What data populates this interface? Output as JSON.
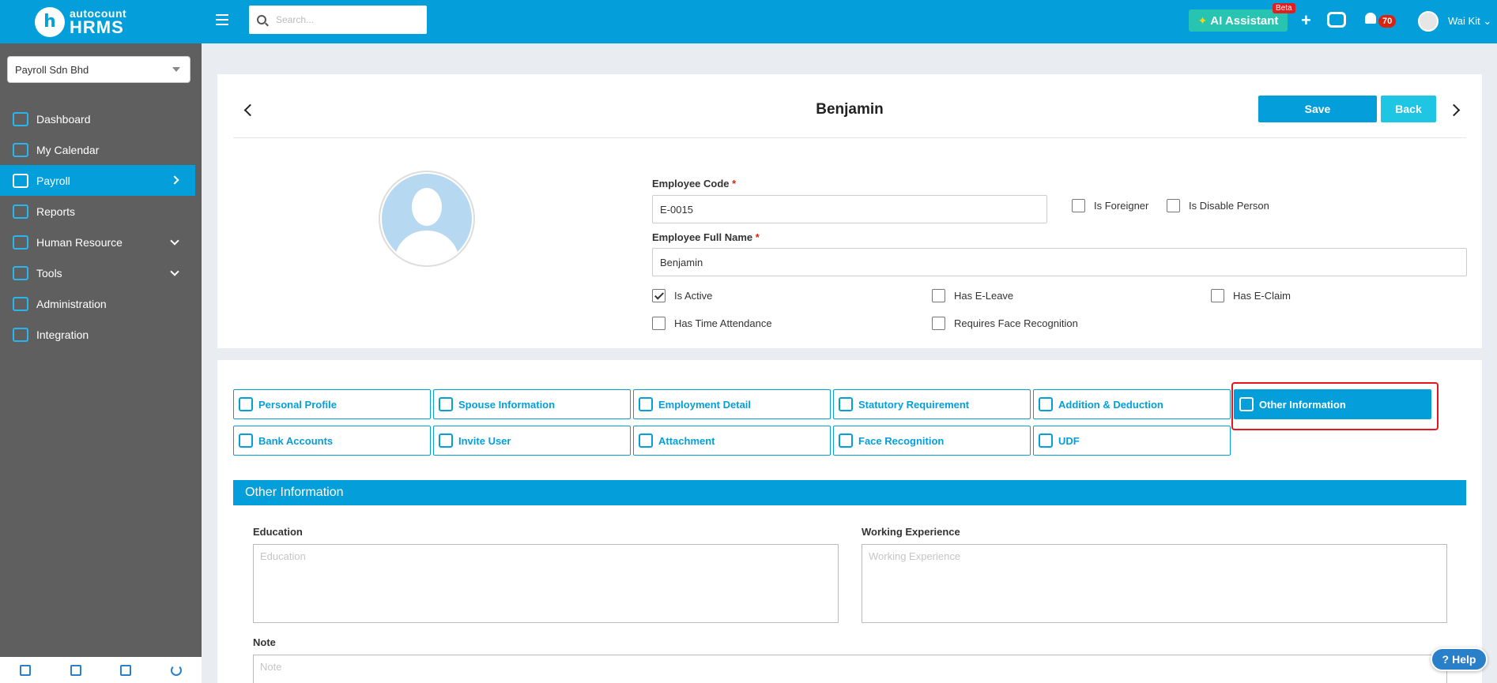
{
  "brand": {
    "logo_letter": "h",
    "line1": "autocount",
    "line2": "HRMS"
  },
  "company": {
    "selected": "Payroll Sdn Bhd"
  },
  "sidebar": {
    "items": [
      {
        "label": "Dashboard",
        "icon": "dashboard-icon"
      },
      {
        "label": "My Calendar",
        "icon": "calendar-icon"
      },
      {
        "label": "Payroll",
        "icon": "payroll-icon",
        "active": true
      },
      {
        "label": "Reports",
        "icon": "reports-icon"
      },
      {
        "label": "Human Resource",
        "icon": "human-resource-icon"
      },
      {
        "label": "Tools",
        "icon": "tools-icon"
      },
      {
        "label": "Administration",
        "icon": "administration-icon"
      },
      {
        "label": "Integration",
        "icon": "integration-icon"
      }
    ]
  },
  "topbar": {
    "search_placeholder": "Search...",
    "ai_label": "AI Assistant",
    "beta": "Beta",
    "plus": "+",
    "notification_count": "70",
    "user_name": "Wai Kit"
  },
  "employee": {
    "title": "Benjamin",
    "save_label": "Save",
    "back_label": "Back",
    "code_label": "Employee Code",
    "code_value": "E-0015",
    "fullname_label": "Employee Full Name",
    "fullname_value": "Benjamin",
    "required_mark": "*",
    "checkboxes": {
      "is_foreigner": "Is Foreigner",
      "is_disable_person": "Is Disable Person",
      "is_active": "Is Active",
      "has_eleave": "Has E-Leave",
      "has_eclaim": "Has E-Claim",
      "has_time_attendance": "Has Time Attendance",
      "requires_face_recognition": "Requires Face Recognition"
    }
  },
  "tabs": {
    "personal_profile": "Personal Profile",
    "spouse_information": "Spouse Information",
    "employment_detail": "Employment Detail",
    "statutory_requirement": "Statutory Requirement",
    "addition_deduction": "Addition & Deduction",
    "other_information": "Other Information",
    "bank_accounts": "Bank Accounts",
    "invite_user": "Invite User",
    "attachment": "Attachment",
    "face_recognition": "Face Recognition",
    "udf": "UDF"
  },
  "other_information": {
    "header": "Other Information",
    "education_label": "Education",
    "education_placeholder": "Education",
    "working_experience_label": "Working Experience",
    "working_experience_placeholder": "Working Experience",
    "note_label": "Note",
    "note_placeholder": "Note"
  },
  "help_label": "Help",
  "colors": {
    "primary": "#049fdb",
    "sidebar": "#5f5f5f",
    "ai": "#27c4b1",
    "highlight": "#e5161f"
  }
}
